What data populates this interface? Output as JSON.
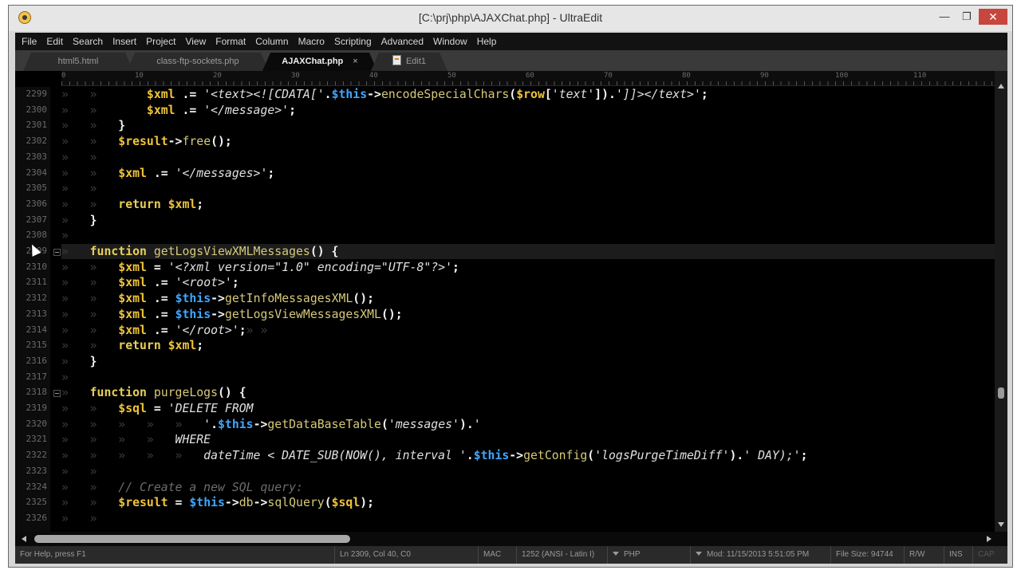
{
  "window": {
    "title": "[C:\\prj\\php\\AJAXChat.php] - UltraEdit",
    "minimize_glyph": "—",
    "maximize_glyph": "❐",
    "close_glyph": "✕"
  },
  "menu": [
    "File",
    "Edit",
    "Search",
    "Insert",
    "Project",
    "View",
    "Format",
    "Column",
    "Macro",
    "Scripting",
    "Advanced",
    "Window",
    "Help"
  ],
  "tabs": [
    {
      "label": "html5.html",
      "active": false
    },
    {
      "label": "class-ftp-sockets.php",
      "active": false
    },
    {
      "label": "AJAXChat.php",
      "active": true
    },
    {
      "label": "Edit1",
      "active": false,
      "icon": "file-icon"
    }
  ],
  "ruler": [
    "0",
    "10",
    "20",
    "30",
    "40",
    "50",
    "60",
    "70",
    "80",
    "90",
    "100",
    "110"
  ],
  "line_numbers": [
    "2299",
    "2300",
    "2301",
    "2302",
    "2303",
    "2304",
    "2305",
    "2306",
    "2307",
    "2308",
    "2309",
    "2310",
    "2311",
    "2312",
    "2313",
    "2314",
    "2315",
    "2316",
    "2317",
    "2318",
    "2319",
    "2320",
    "2321",
    "2322",
    "2323",
    "2324",
    "2325",
    "2326"
  ],
  "code": [
    [
      [
        "ws",
        "»   »       "
      ],
      [
        "var",
        "$xml"
      ],
      [
        "op",
        " .= "
      ],
      [
        "st",
        "'<text><![CDATA['"
      ],
      [
        "op",
        "."
      ],
      [
        "th",
        "$this"
      ],
      [
        "op",
        "->"
      ],
      [
        "fn",
        "encodeSpecialChars"
      ],
      [
        "op",
        "("
      ],
      [
        "var",
        "$row"
      ],
      [
        "op",
        "["
      ],
      [
        "st",
        "'text'"
      ],
      [
        "op",
        "])."
      ],
      [
        "st",
        "']]></text>'"
      ],
      [
        "op",
        ";"
      ]
    ],
    [
      [
        "ws",
        "»   »       "
      ],
      [
        "var",
        "$xml"
      ],
      [
        "op",
        " .= "
      ],
      [
        "st",
        "'</message>'"
      ],
      [
        "op",
        ";"
      ]
    ],
    [
      [
        "ws",
        "»   »   "
      ],
      [
        "op",
        "}"
      ]
    ],
    [
      [
        "ws",
        "»   »   "
      ],
      [
        "var",
        "$result"
      ],
      [
        "op",
        "->"
      ],
      [
        "fn",
        "free"
      ],
      [
        "op",
        "();"
      ]
    ],
    [
      [
        "ws",
        "»   »"
      ]
    ],
    [
      [
        "ws",
        "»   »   "
      ],
      [
        "var",
        "$xml"
      ],
      [
        "op",
        " .= "
      ],
      [
        "st",
        "'</messages>'"
      ],
      [
        "op",
        ";"
      ]
    ],
    [
      [
        "ws",
        "»   »"
      ]
    ],
    [
      [
        "ws",
        "»   »   "
      ],
      [
        "kw",
        "return "
      ],
      [
        "var",
        "$xml"
      ],
      [
        "op",
        ";"
      ]
    ],
    [
      [
        "ws",
        "»   "
      ],
      [
        "op",
        "}"
      ]
    ],
    [
      [
        "ws",
        "»"
      ]
    ],
    [
      [
        "ws",
        "»   "
      ],
      [
        "kw",
        "function "
      ],
      [
        "fn",
        "getLogsViewXMLMessages"
      ],
      [
        "op",
        "() {"
      ]
    ],
    [
      [
        "ws",
        "»   »   "
      ],
      [
        "var",
        "$xml"
      ],
      [
        "op",
        " = "
      ],
      [
        "st",
        "'<?xml version=\"1.0\" encoding=\"UTF-8\"?>'"
      ],
      [
        "op",
        ";"
      ]
    ],
    [
      [
        "ws",
        "»   »   "
      ],
      [
        "var",
        "$xml"
      ],
      [
        "op",
        " .= "
      ],
      [
        "st",
        "'<root>'"
      ],
      [
        "op",
        ";"
      ]
    ],
    [
      [
        "ws",
        "»   »   "
      ],
      [
        "var",
        "$xml"
      ],
      [
        "op",
        " .= "
      ],
      [
        "th",
        "$this"
      ],
      [
        "op",
        "->"
      ],
      [
        "fn",
        "getInfoMessagesXML"
      ],
      [
        "op",
        "();"
      ]
    ],
    [
      [
        "ws",
        "»   »   "
      ],
      [
        "var",
        "$xml"
      ],
      [
        "op",
        " .= "
      ],
      [
        "th",
        "$this"
      ],
      [
        "op",
        "->"
      ],
      [
        "fn",
        "getLogsViewMessagesXML"
      ],
      [
        "op",
        "();"
      ]
    ],
    [
      [
        "ws",
        "»   »   "
      ],
      [
        "var",
        "$xml"
      ],
      [
        "op",
        " .= "
      ],
      [
        "st",
        "'</root>'"
      ],
      [
        "op",
        ";"
      ],
      [
        "ws",
        "» »"
      ]
    ],
    [
      [
        "ws",
        "»   »   "
      ],
      [
        "kw",
        "return "
      ],
      [
        "var",
        "$xml"
      ],
      [
        "op",
        ";"
      ]
    ],
    [
      [
        "ws",
        "»   "
      ],
      [
        "op",
        "}"
      ]
    ],
    [
      [
        "ws",
        "»"
      ]
    ],
    [
      [
        "ws",
        "»   "
      ],
      [
        "kw",
        "function "
      ],
      [
        "fn",
        "purgeLogs"
      ],
      [
        "op",
        "() {"
      ]
    ],
    [
      [
        "ws",
        "»   »   "
      ],
      [
        "var",
        "$sql"
      ],
      [
        "op",
        " = "
      ],
      [
        "st",
        "'DELETE FROM"
      ]
    ],
    [
      [
        "ws",
        "»   »   »   »   »   "
      ],
      [
        "st",
        "'"
      ],
      [
        "op",
        "."
      ],
      [
        "th",
        "$this"
      ],
      [
        "op",
        "->"
      ],
      [
        "fn",
        "getDataBaseTable"
      ],
      [
        "op",
        "("
      ],
      [
        "st",
        "'messages'"
      ],
      [
        "op",
        ")."
      ],
      [
        "st",
        "'"
      ]
    ],
    [
      [
        "ws",
        "»   »   »   »   "
      ],
      [
        "st",
        "WHERE"
      ]
    ],
    [
      [
        "ws",
        "»   »   »   »   »   "
      ],
      [
        "st",
        "dateTime < DATE_SUB(NOW(), interval '"
      ],
      [
        "op",
        "."
      ],
      [
        "th",
        "$this"
      ],
      [
        "op",
        "->"
      ],
      [
        "fn",
        "getConfig"
      ],
      [
        "op",
        "("
      ],
      [
        "st",
        "'logsPurgeTimeDiff'"
      ],
      [
        "op",
        ")."
      ],
      [
        "st",
        "' DAY);'"
      ],
      [
        "op",
        ";"
      ]
    ],
    [
      [
        "ws",
        "»   »"
      ]
    ],
    [
      [
        "ws",
        "»   »   "
      ],
      [
        "cm",
        "// Create a new SQL query:"
      ]
    ],
    [
      [
        "ws",
        "»   »   "
      ],
      [
        "var",
        "$result"
      ],
      [
        "op",
        " = "
      ],
      [
        "th",
        "$this"
      ],
      [
        "op",
        "->"
      ],
      [
        "fn",
        "db"
      ],
      [
        "op",
        "->"
      ],
      [
        "fn",
        "sqlQuery"
      ],
      [
        "op",
        "("
      ],
      [
        "var",
        "$sql"
      ],
      [
        "op",
        ");"
      ]
    ],
    [
      [
        "ws",
        "»   »"
      ]
    ]
  ],
  "status": {
    "help": "For Help, press F1",
    "position": "Ln 2309, Col 40, C0",
    "line_ending": "MAC",
    "encoding": "1252  (ANSI - Latin I)",
    "language": "PHP",
    "modified": "Mod: 11/15/2013 5:51:05 PM",
    "file_size": "File Size: 94744",
    "rw": "R/W",
    "ins": "INS",
    "cap": "CAP"
  }
}
